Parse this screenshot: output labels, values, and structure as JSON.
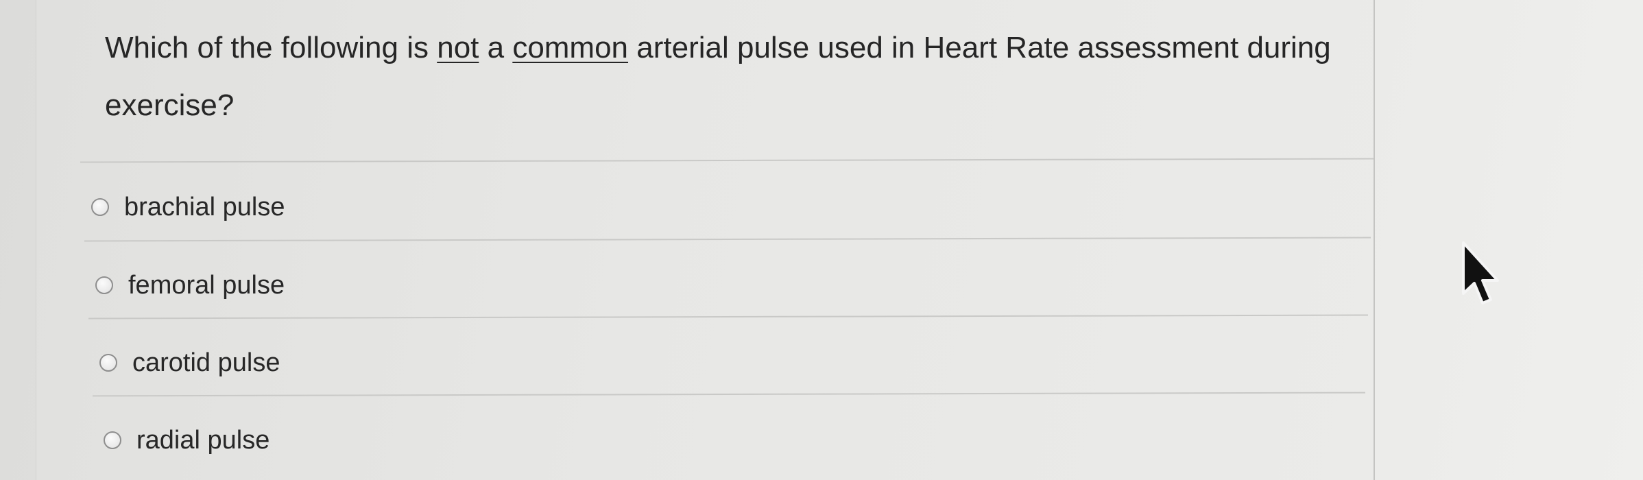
{
  "question": {
    "part1": "Which of the following is ",
    "underline1": "not",
    "part2": " a ",
    "underline2": "common",
    "part3": " arterial pulse used in Heart Rate assessment during exercise?"
  },
  "options": [
    {
      "label": "brachial pulse"
    },
    {
      "label": "femoral pulse"
    },
    {
      "label": "carotid pulse"
    },
    {
      "label": "radial pulse"
    }
  ],
  "cursor": {
    "icon": "arrow-cursor-icon"
  }
}
